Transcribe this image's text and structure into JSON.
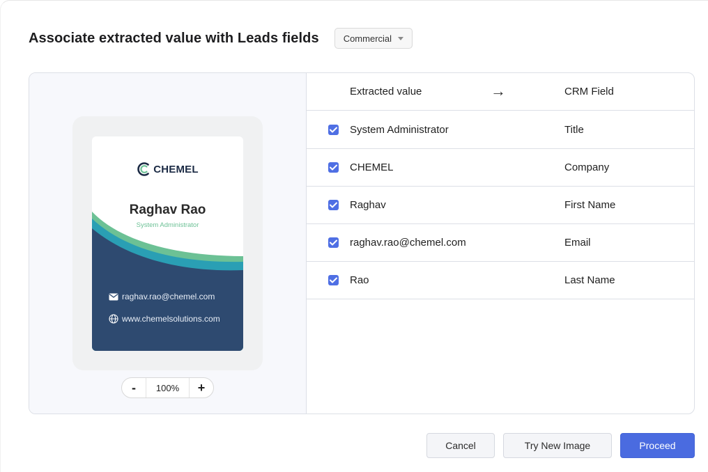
{
  "header": {
    "title": "Associate extracted value with Leads fields",
    "dropdown_value": "Commercial"
  },
  "card": {
    "logo_text": "CHEMEL",
    "name": "Raghav Rao",
    "role": "System Administrator",
    "email": "raghav.rao@chemel.com",
    "website": "www.chemelsolutions.com",
    "colors": {
      "navy": "#2e4a70",
      "teal": "#2a9fb4",
      "green": "#6cc195"
    }
  },
  "zoom": {
    "minus": "-",
    "value": "100%",
    "plus": "+"
  },
  "table": {
    "header_extracted": "Extracted value",
    "header_arrow": "→",
    "header_field": "CRM Field",
    "rows": [
      {
        "value": "System Administrator",
        "field": "Title",
        "checked": true
      },
      {
        "value": "CHEMEL",
        "field": "Company",
        "checked": true
      },
      {
        "value": "Raghav",
        "field": "First Name",
        "checked": true
      },
      {
        "value": "raghav.rao@chemel.com",
        "field": "Email",
        "checked": true
      },
      {
        "value": "Rao",
        "field": "Last Name",
        "checked": true
      }
    ]
  },
  "footer": {
    "cancel_label": "Cancel",
    "try_label": "Try New Image",
    "proceed_label": "Proceed"
  },
  "colors": {
    "accent": "#4a6be0"
  }
}
